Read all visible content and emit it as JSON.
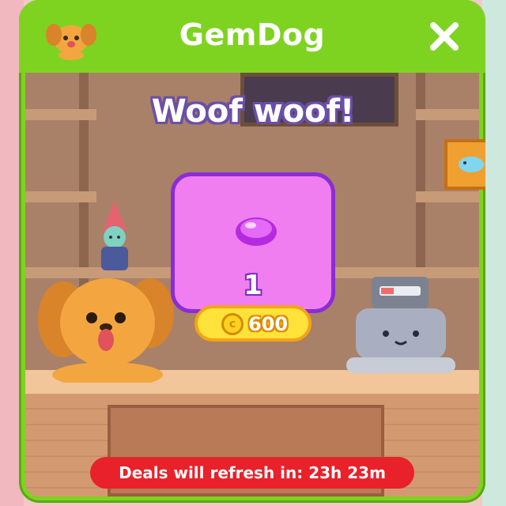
{
  "header": {
    "title": "GemDog",
    "close_icon": "close-x-icon",
    "logo_icon": "dog-face-icon"
  },
  "shop": {
    "greeting": "Woof woof!",
    "deal": {
      "item_icon": "pink-gem-icon",
      "quantity": "1",
      "currency_icon": "coin-icon",
      "currency_symbol": "c",
      "price": "600"
    },
    "refresh_banner": "Deals will refresh in: 23h 23m"
  },
  "colors": {
    "header_green": "#7ed321",
    "card_pink": "#f07ef0",
    "card_border": "#8a2dd4",
    "price_yellow": "#ffe23a",
    "banner_red": "#e8212a"
  }
}
